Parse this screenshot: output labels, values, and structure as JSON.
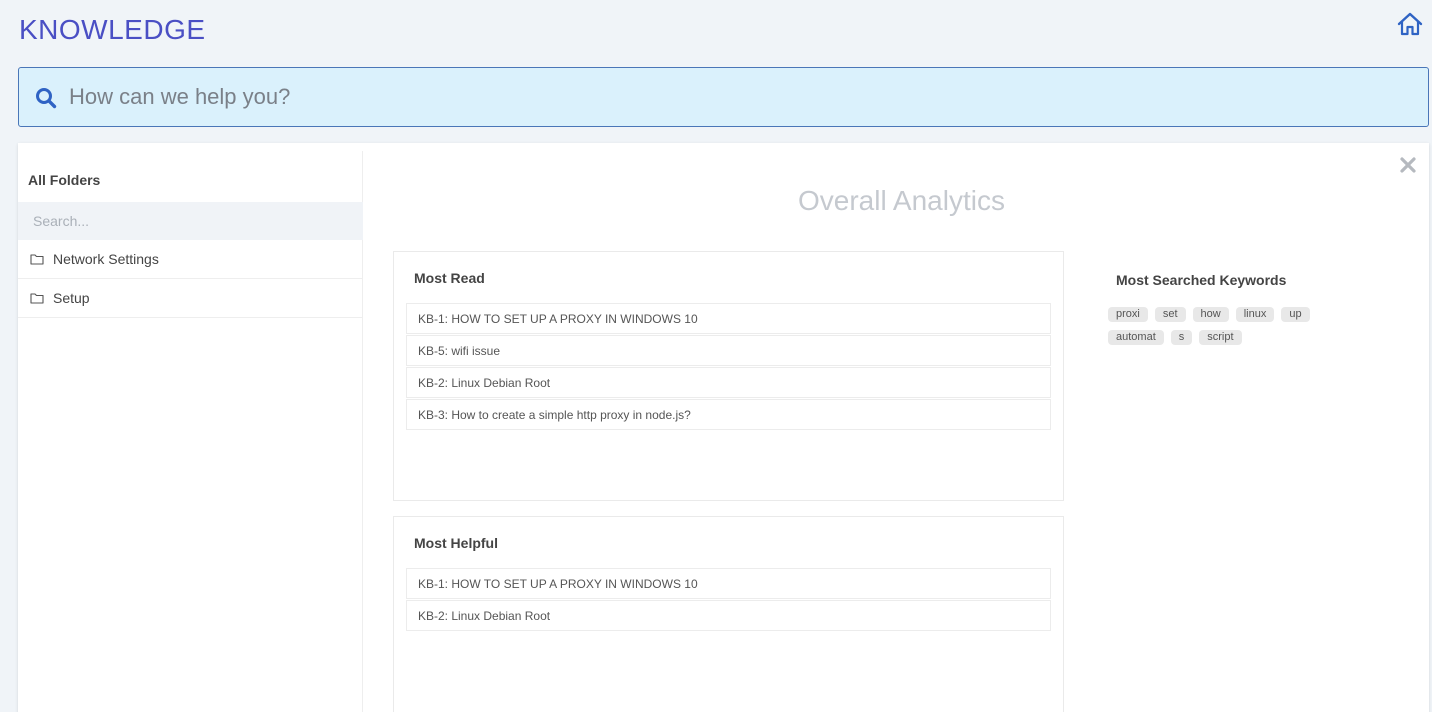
{
  "header": {
    "title": "KNOWLEDGE"
  },
  "search": {
    "placeholder": "How can we help you?"
  },
  "sidebar": {
    "title": "All Folders",
    "search_placeholder": "Search...",
    "folders": [
      {
        "label": "Network Settings"
      },
      {
        "label": "Setup"
      }
    ]
  },
  "main": {
    "title": "Overall Analytics",
    "most_read": {
      "title": "Most Read",
      "items": [
        "KB-1: HOW TO SET UP A PROXY IN WINDOWS 10",
        "KB-5: wifi issue",
        "KB-2: Linux Debian Root",
        "KB-3: How to create a simple http proxy in node.js?"
      ]
    },
    "most_helpful": {
      "title": "Most Helpful",
      "items": [
        "KB-1: HOW TO SET UP A PROXY IN WINDOWS 10",
        "KB-2: Linux Debian Root"
      ]
    },
    "keywords": {
      "title": "Most Searched Keywords",
      "tags": [
        "proxi",
        "set",
        "how",
        "linux",
        "up",
        "automat",
        "s",
        "script"
      ]
    }
  },
  "colors": {
    "accent": "#4a4fc4",
    "search_bg": "#daf1fc",
    "icon_blue": "#2f63c4"
  },
  "icons": {
    "home": "home-icon",
    "search": "search-icon",
    "close": "close-icon",
    "folder": "folder-icon"
  }
}
